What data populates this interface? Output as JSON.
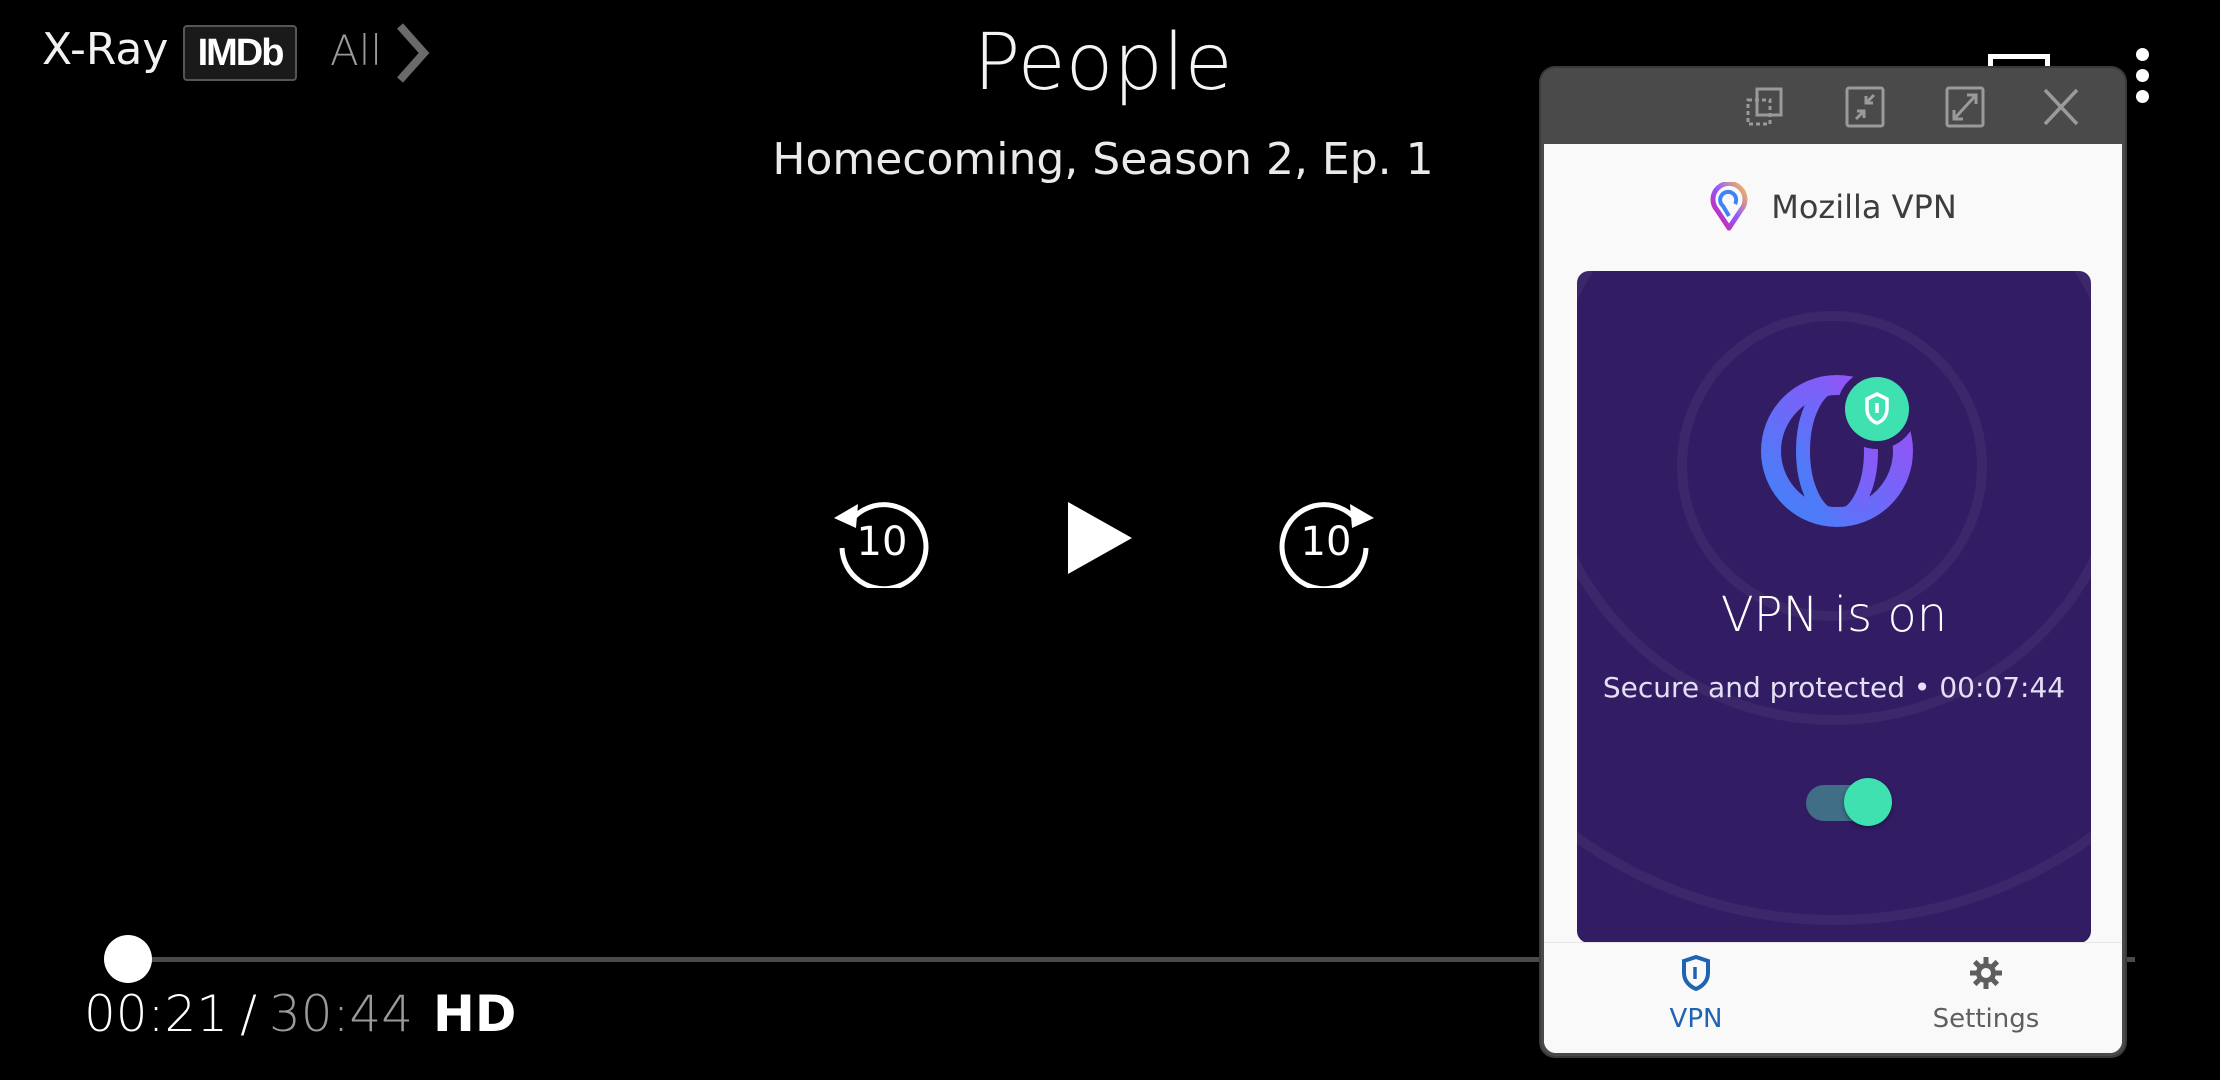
{
  "player": {
    "xray_label": "X-Ray",
    "imdb_label": "IMDb",
    "all_label": "All",
    "title": "People",
    "subtitle": "Homecoming, Season 2, Ep. 1",
    "rewind_seconds": "10",
    "forward_seconds": "10",
    "current_time": "00:21",
    "separator": "/",
    "total_time": "30:44",
    "quality": "HD",
    "progress_fraction": 0.0114,
    "buffered_fraction": 0.02
  },
  "vpn_panel": {
    "app_name": "Mozilla VPN",
    "status_title": "VPN is on",
    "status_detail": "Secure and protected • 00:07:44",
    "toggle_on": true,
    "nav": [
      {
        "label": "VPN",
        "icon": "shield-icon",
        "active": true
      },
      {
        "label": "Settings",
        "icon": "gear-icon",
        "active": false
      }
    ],
    "window_buttons": [
      "resize-icon",
      "minimize-icon",
      "maximize-icon",
      "close-icon"
    ],
    "colors": {
      "card_bg": "#321c64",
      "accent_green": "#3fe1b0",
      "nav_active": "#1f64b0",
      "globe_gradient_start": "#3f83f8",
      "globe_gradient_end": "#a24cf7"
    }
  }
}
